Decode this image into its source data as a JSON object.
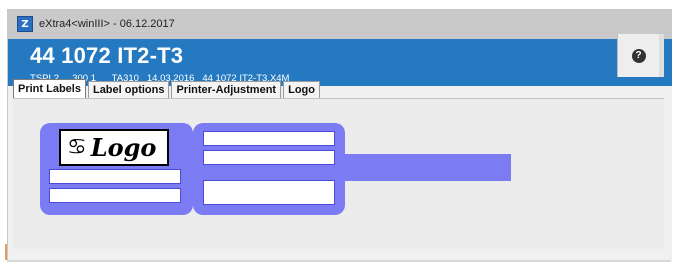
{
  "window": {
    "title": "eXtra4<winIII> - 06.12.2017",
    "app_icon": "Z"
  },
  "header": {
    "title": "44 1072 IT2-T3",
    "meta": "TSPL2     300 1      TA310   14.03.2016   44 1072 IT2-T3.X4M",
    "help_icon": "?"
  },
  "tabs": [
    {
      "label": "Print Labels",
      "active": true
    },
    {
      "label": "Label options",
      "active": false
    },
    {
      "label": "Printer-Adjustment",
      "active": false
    },
    {
      "label": "Logo",
      "active": false
    }
  ],
  "label_preview": {
    "logo_text": "Logo",
    "logo_symbol": "♋",
    "colors": {
      "label": "#7b7bf4",
      "field": "#ffffff",
      "header": "#2579c1"
    }
  }
}
